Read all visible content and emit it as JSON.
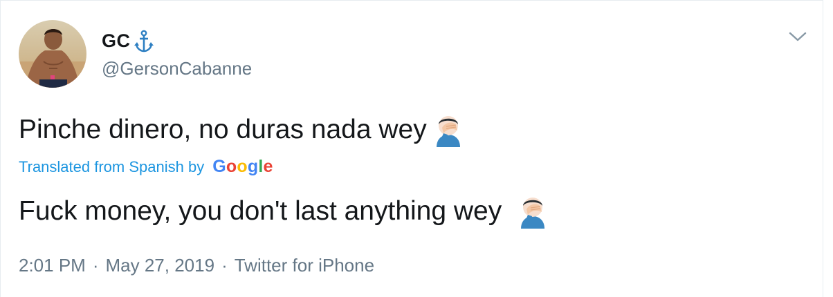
{
  "author": {
    "display_name": "GC",
    "handle": "@GersonCabanne",
    "avatar_icon": "avatar-photo",
    "badge_icon": "anchor-icon"
  },
  "tweet": {
    "text": "Pinche dinero, no duras nada wey",
    "emoji": "facepalm-icon"
  },
  "translation": {
    "label": "Translated from Spanish by",
    "provider": "Google",
    "text": "Fuck money, you don't last anything wey",
    "emoji": "facepalm-icon"
  },
  "meta": {
    "time": "2:01 PM",
    "date": "May 27, 2019",
    "source": "Twitter for iPhone",
    "separator": "·"
  },
  "colors": {
    "text": "#14171a",
    "secondary": "#657786",
    "link": "#1b95e0",
    "border": "#e6ecf0"
  }
}
